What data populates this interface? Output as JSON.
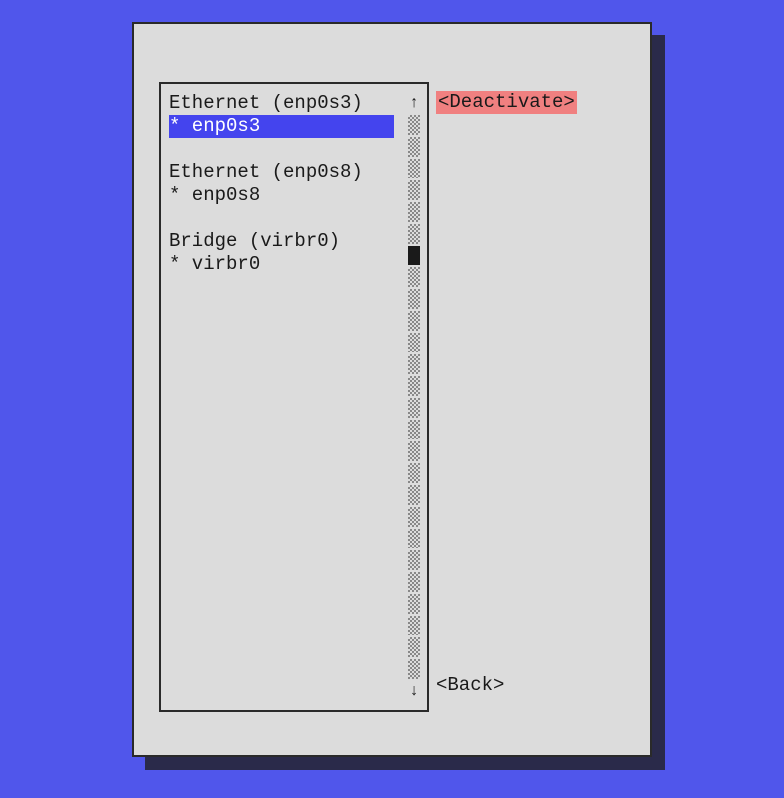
{
  "connections": {
    "groups": [
      {
        "header": "Ethernet (enp0s3)",
        "items": [
          {
            "text": "* enp0s3",
            "selected": true
          }
        ]
      },
      {
        "header": "Ethernet (enp0s8)",
        "items": [
          {
            "text": "* enp0s8",
            "selected": false
          }
        ]
      },
      {
        "header": "Bridge (virbr0)",
        "items": [
          {
            "text": "* virbr0",
            "selected": false
          }
        ]
      }
    ]
  },
  "buttons": {
    "deactivate": "<Deactivate>",
    "back": "<Back>"
  },
  "scroll": {
    "up_arrow": "↑",
    "down_arrow": "↓",
    "segments": 26,
    "thumb_index": 6
  }
}
